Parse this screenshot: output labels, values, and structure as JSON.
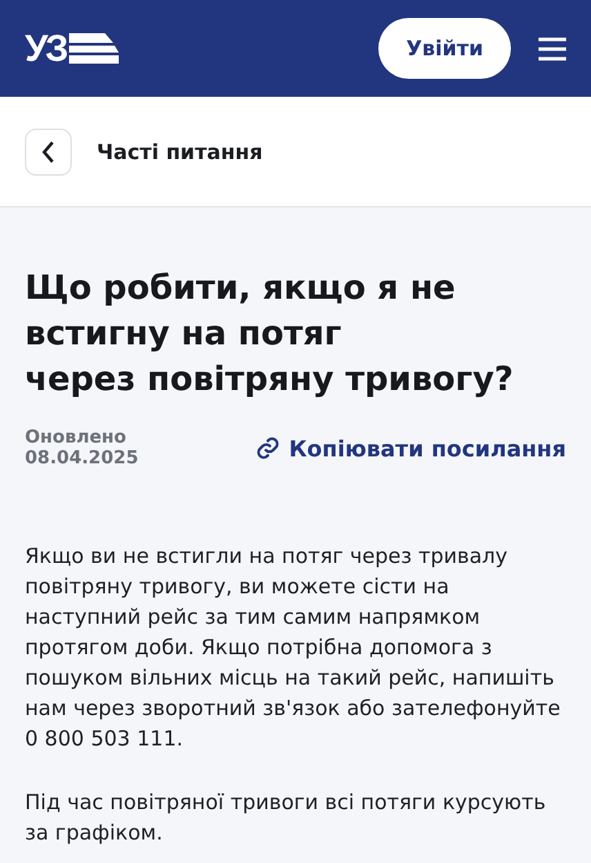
{
  "header": {
    "logo": "УЗ",
    "login_button": "Увійти"
  },
  "breadcrumb": {
    "label": "Часті питання"
  },
  "article": {
    "title": "Що робити, якщо я не\nвстигну на потяг\nчерез повітряну тривогу?",
    "updated": "Оновлено 08.04.2025",
    "copy_link": "Копіювати посилання",
    "paragraphs": [
      "Якщо ви не встигли на потяг через тривалу повітряну тривогу, ви можете сісти на наступний рейс за тим самим напрямком протягом доби. Якщо потрібна допомога з пошуком вільних місць на такий рейс, напишіть нам через зворотний зв'язок або зателефонуйте 0 800 503 111.",
      "Під час повітряної тривоги всі потяги курсують\nза графіком."
    ]
  }
}
